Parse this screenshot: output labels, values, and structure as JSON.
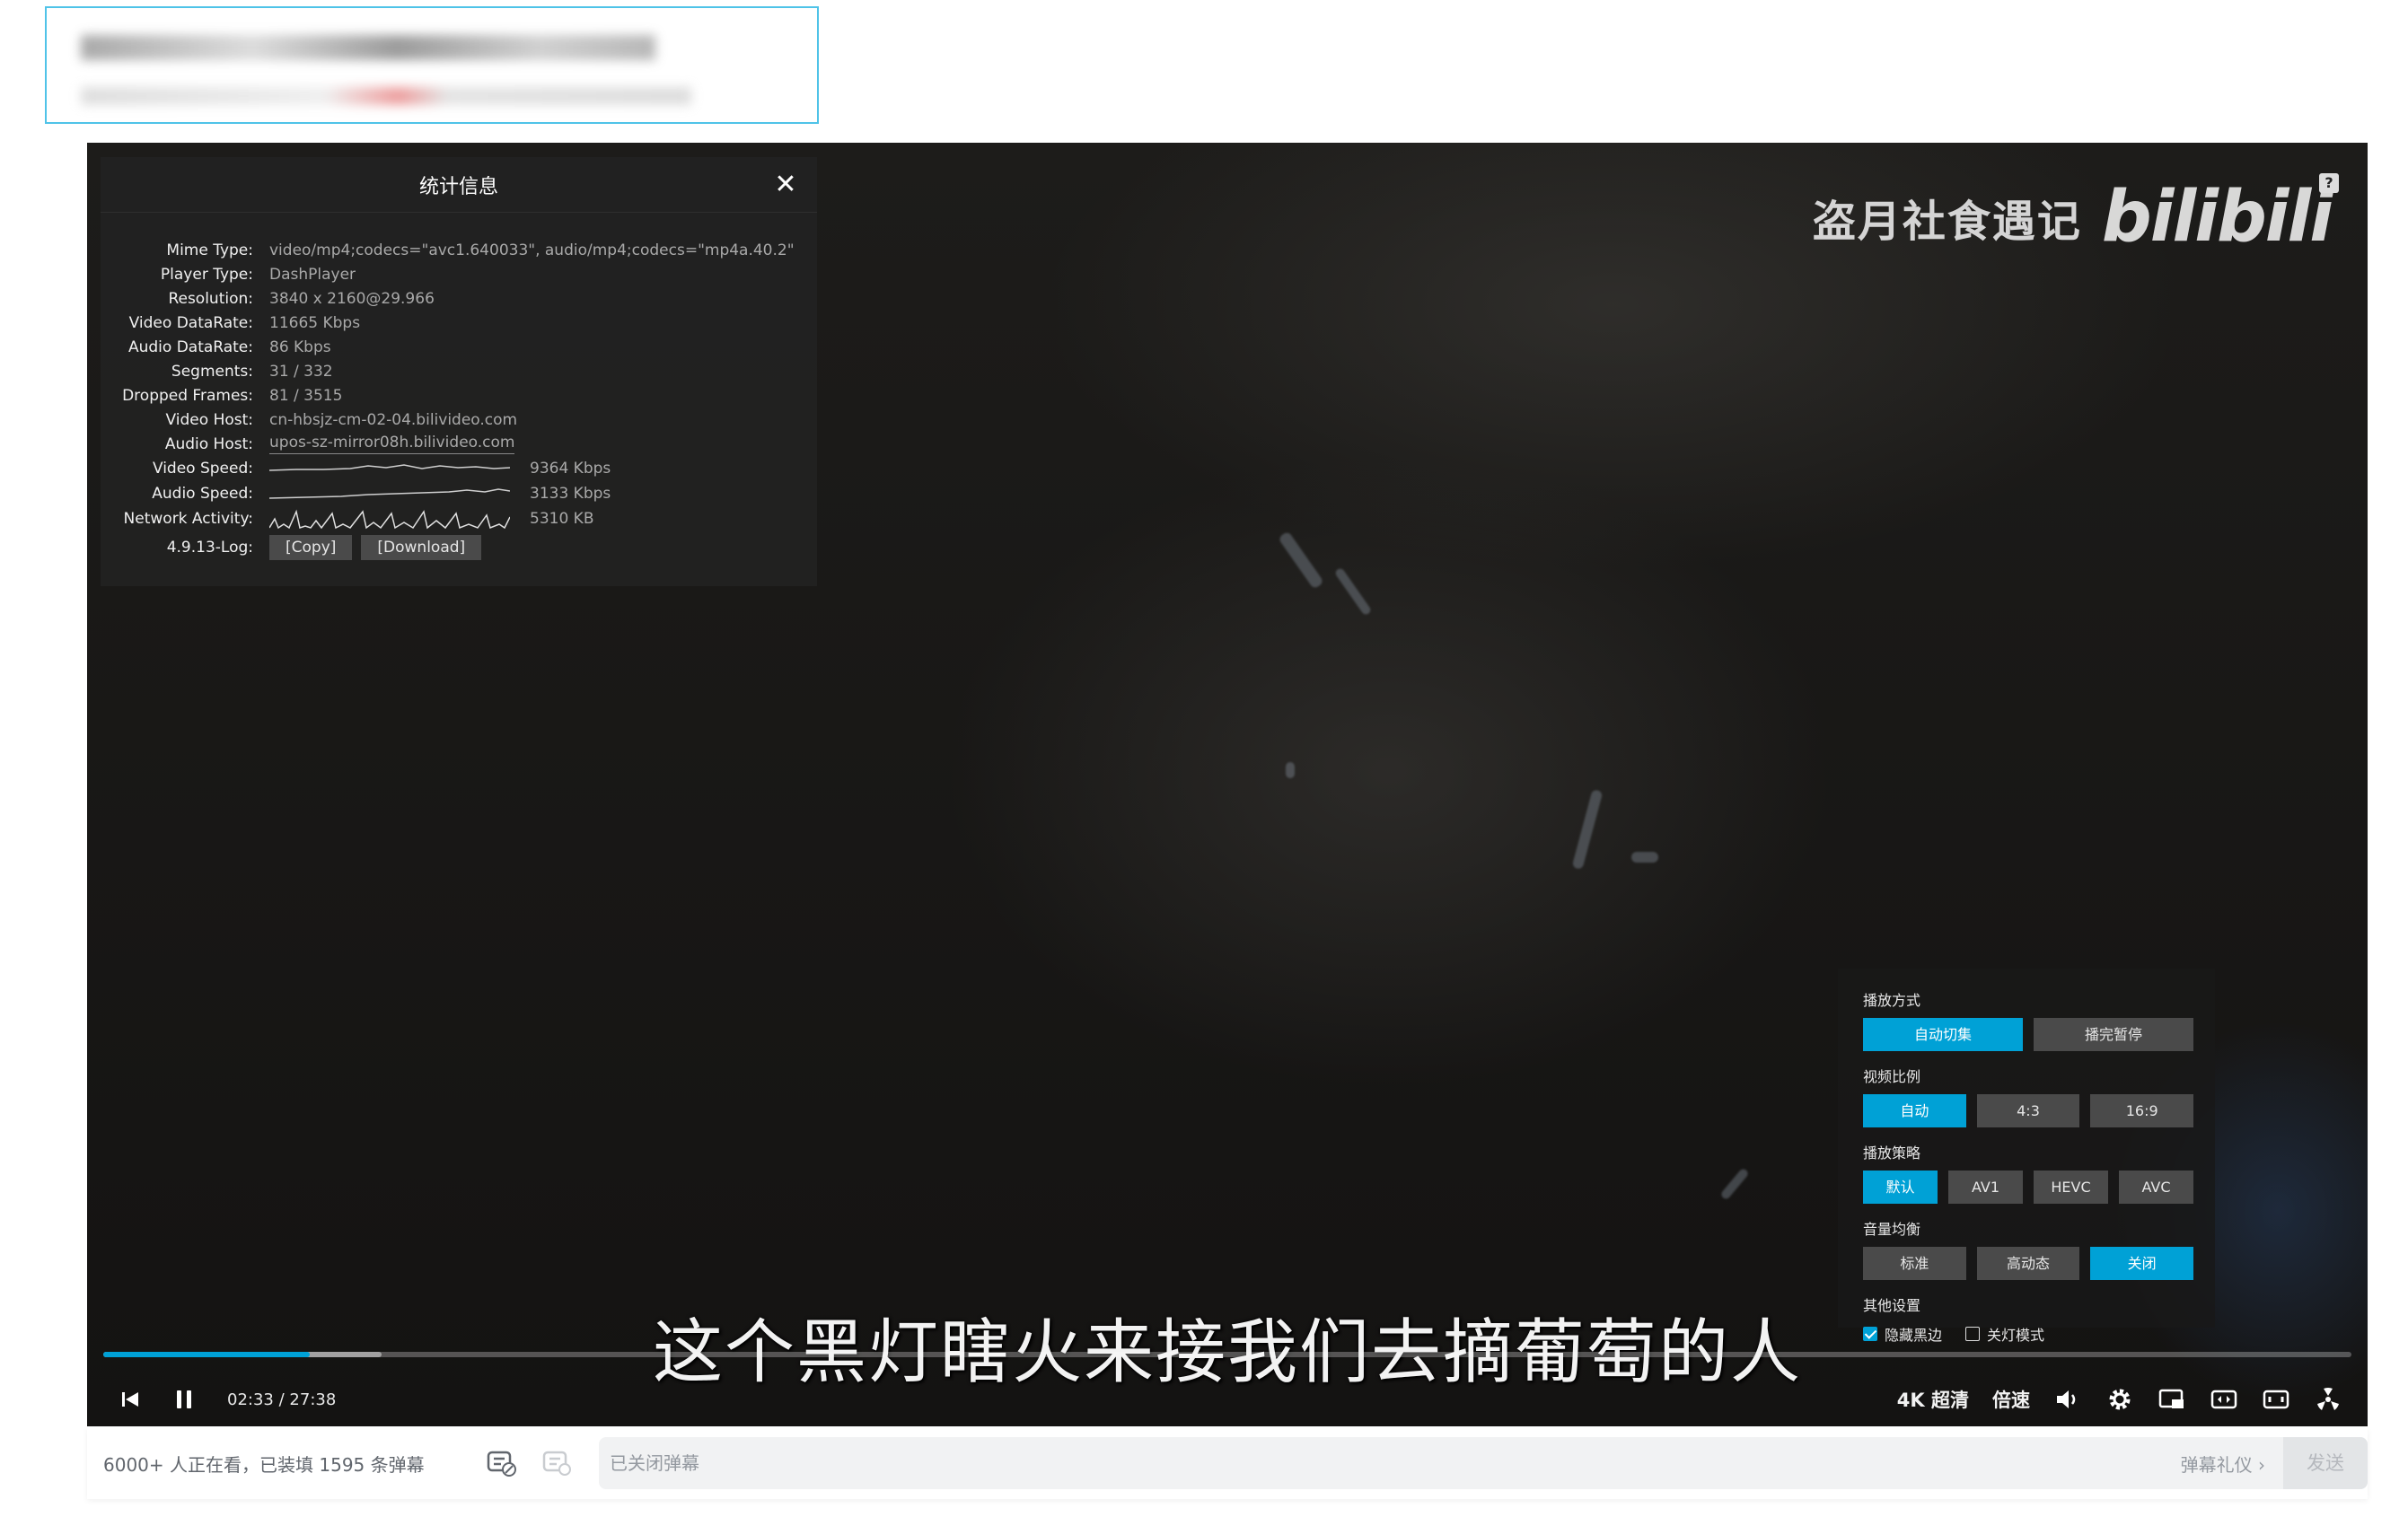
{
  "stats": {
    "title": "统计信息",
    "rows": [
      {
        "label": "Mime Type:",
        "value": "video/mp4;codecs=\"avc1.640033\", audio/mp4;codecs=\"mp4a.40.2\""
      },
      {
        "label": "Player Type:",
        "value": "DashPlayer"
      },
      {
        "label": "Resolution:",
        "value": "3840 x 2160@29.966"
      },
      {
        "label": "Video DataRate:",
        "value": "11665 Kbps"
      },
      {
        "label": "Audio DataRate:",
        "value": "86 Kbps"
      },
      {
        "label": "Segments:",
        "value": "31 / 332"
      },
      {
        "label": "Dropped Frames:",
        "value": "81 / 3515"
      },
      {
        "label": "Video Host:",
        "value": "cn-hbsjz-cm-02-04.bilivideo.com"
      },
      {
        "label": "Audio Host:",
        "value": "upos-sz-mirror08h.bilivideo.com"
      }
    ],
    "video_speed": {
      "label": "Video Speed:",
      "value": "9364 Kbps"
    },
    "audio_speed": {
      "label": "Audio Speed:",
      "value": "3133 Kbps"
    },
    "network": {
      "label": "Network Activity:",
      "value": "5310 KB"
    },
    "log": {
      "label": "4.9.13-Log:",
      "copy": "[Copy]",
      "download": "[Download]"
    }
  },
  "watermark": {
    "channel": "盗月社食遇记",
    "logo": "bilibili"
  },
  "settings": {
    "play_mode": {
      "title": "播放方式",
      "options": [
        "自动切集",
        "播完暂停"
      ],
      "active": 0
    },
    "aspect": {
      "title": "视频比例",
      "options": [
        "自动",
        "4:3",
        "16:9"
      ],
      "active": 0
    },
    "strategy": {
      "title": "播放策略",
      "options": [
        "默认",
        "AV1",
        "HEVC",
        "AVC"
      ],
      "active": 0
    },
    "volume_eq": {
      "title": "音量均衡",
      "options": [
        "标准",
        "高动态",
        "关闭"
      ],
      "active": 2
    },
    "other": {
      "title": "其他设置",
      "hide_black": "隐藏黑边",
      "lights_off": "关灯模式",
      "hide_black_checked": true,
      "lights_off_checked": false
    }
  },
  "subtitle": "这个黑灯瞎火来接我们去摘葡萄的人",
  "playback": {
    "current": "02:33",
    "separator": "/",
    "duration": "27:38",
    "played_fraction": 0.092,
    "buffered_fraction": 0.124
  },
  "controls": {
    "quality": "4K 超清",
    "speed": "倍速"
  },
  "danmaku": {
    "info": "6000+ 人正在看，已装填 1595 条弹幕",
    "placeholder": "已关闭弹幕",
    "etiquette": "弹幕礼仪 ›",
    "send": "发送"
  },
  "colors": {
    "accent": "#00a1d6",
    "panel": "#222222"
  }
}
